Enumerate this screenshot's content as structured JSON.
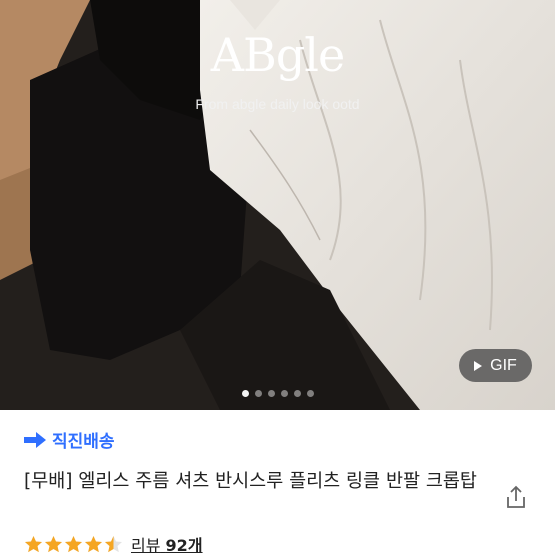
{
  "hero": {
    "brand": "ABgle",
    "tagline": "From abgle daily look ootd",
    "gif_label": "GIF",
    "carousel_dots": 6,
    "active_dot": 0
  },
  "shipping": {
    "label": "직진배송",
    "color": "#2f6fff"
  },
  "product": {
    "title": "[무배] 엘리스 주름 셔츠 반시스루 플리츠 링클 반팔 크롭탑"
  },
  "rating": {
    "score": 4.5,
    "max": 5,
    "star_color": "#f5a623",
    "review_label": "리뷰",
    "review_count": "92개"
  },
  "icons": {
    "share": "share-icon",
    "arrow": "arrow-right-icon",
    "play": "play-icon"
  }
}
